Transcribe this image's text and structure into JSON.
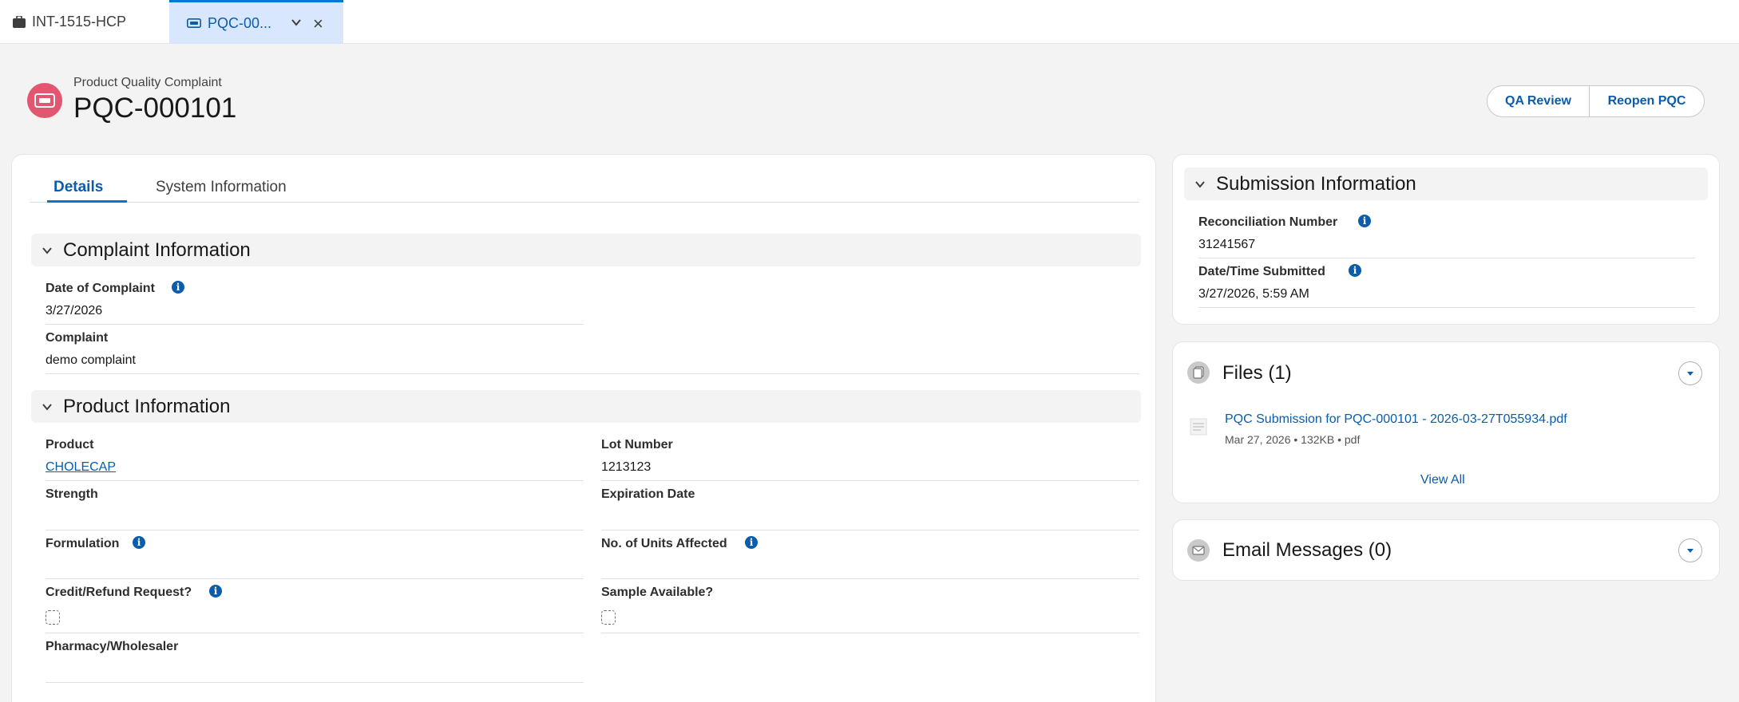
{
  "workspace_tabs": [
    {
      "label": "INT-1515-HCP",
      "icon": "briefcase-icon"
    },
    {
      "label": "PQC-00...",
      "icon": "complaint-icon"
    }
  ],
  "header": {
    "object_type": "Product Quality Complaint",
    "title": "PQC-000101",
    "buttons": {
      "qa_review": "QA Review",
      "reopen": "Reopen PQC"
    }
  },
  "tabs": {
    "details": "Details",
    "system": "System Information"
  },
  "complaint_section": {
    "title": "Complaint Information",
    "date_label": "Date of Complaint",
    "date_value": "3/27/2026",
    "complaint_label": "Complaint",
    "complaint_value": "demo complaint"
  },
  "product_section": {
    "title": "Product Information",
    "product_label": "Product",
    "product_value": "CHOLECAP",
    "lot_label": "Lot Number",
    "lot_value": "1213123",
    "strength_label": "Strength",
    "expiration_label": "Expiration Date",
    "formulation_label": "Formulation",
    "units_label": "No. of Units Affected",
    "credit_label": "Credit/Refund Request?",
    "sample_label": "Sample Available?",
    "pharmacy_label": "Pharmacy/Wholesaler"
  },
  "submission": {
    "title": "Submission Information",
    "recon_label": "Reconciliation Number",
    "recon_value": "31241567",
    "datetime_label": "Date/Time Submitted",
    "datetime_value": "3/27/2026, 5:59 AM"
  },
  "files": {
    "title": "Files (1)",
    "file_name": "PQC Submission for PQC-000101 - 2026-03-27T055934.pdf",
    "file_meta": "Mar 27, 2026 • 132KB • pdf",
    "view_all": "View All"
  },
  "email": {
    "title": "Email Messages (0)"
  },
  "colors": {
    "accent": "#0176d3",
    "record_icon": "#e3566f",
    "link": "#0b5cab"
  }
}
